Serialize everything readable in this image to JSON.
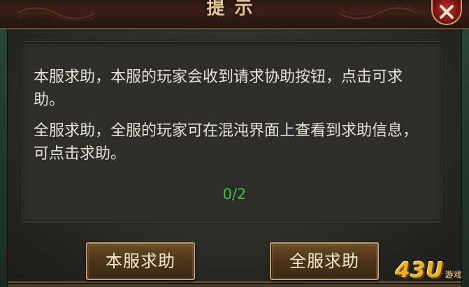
{
  "dialog": {
    "title": "提示",
    "close_icon": "close-x-icon",
    "paragraph_local": "本服求助，本服的玩家会收到请求协助按钮，点击可求助。",
    "paragraph_all": "全服求助，全服的玩家可在混沌界面上查看到求助信息，可点击求助。",
    "counter": "0/2",
    "buttons": {
      "local_help": "本服求助",
      "all_help": "全服求助"
    }
  },
  "watermark": {
    "text": "43U",
    "suffix": "游戏"
  },
  "colors": {
    "title": "#e6c98c",
    "counter": "#35c83a",
    "close_button": "#c2302a",
    "button_border": "#c7a263"
  }
}
